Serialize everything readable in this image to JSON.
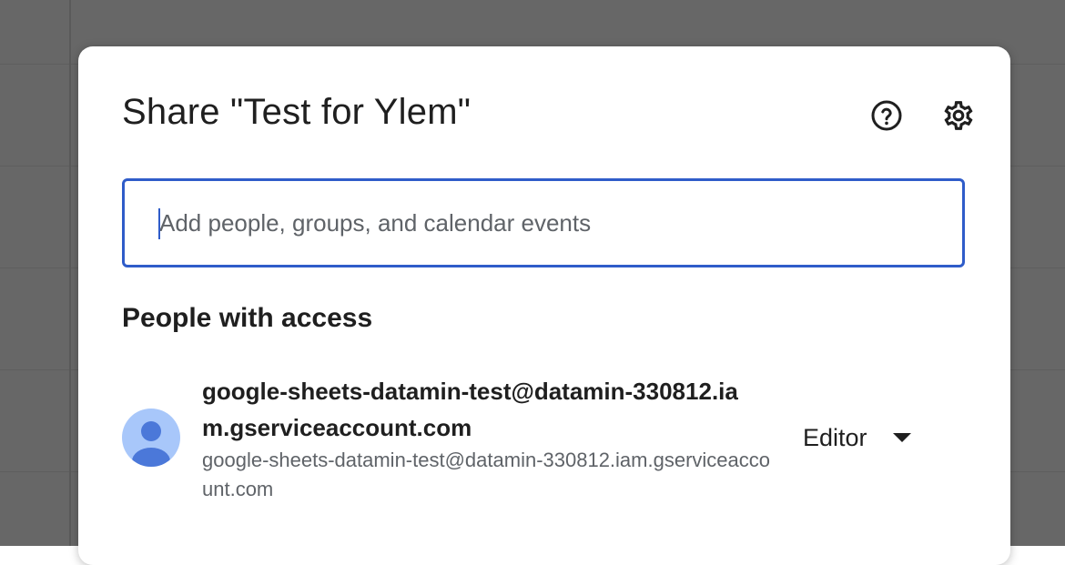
{
  "dialog": {
    "title": "Share \"Test for Ylem\"",
    "help_icon": "help-circle-icon",
    "settings_icon": "gear-icon"
  },
  "share_input": {
    "placeholder": "Add people, groups, and calendar events",
    "value": ""
  },
  "people_section": {
    "heading": "People with access",
    "people": [
      {
        "display_name": "google-sheets-datamin-test@datamin-330812.iam.gserviceaccount.com",
        "email": "google-sheets-datamin-test@datamin-330812.iam.gserviceaccount.com",
        "avatar_icon": "person-icon",
        "role": "Editor"
      }
    ]
  },
  "colors": {
    "accent": "#2f5cc9",
    "avatar_bg": "#a8c7fa",
    "avatar_fg": "#4b78d9",
    "backdrop": "#676767"
  }
}
